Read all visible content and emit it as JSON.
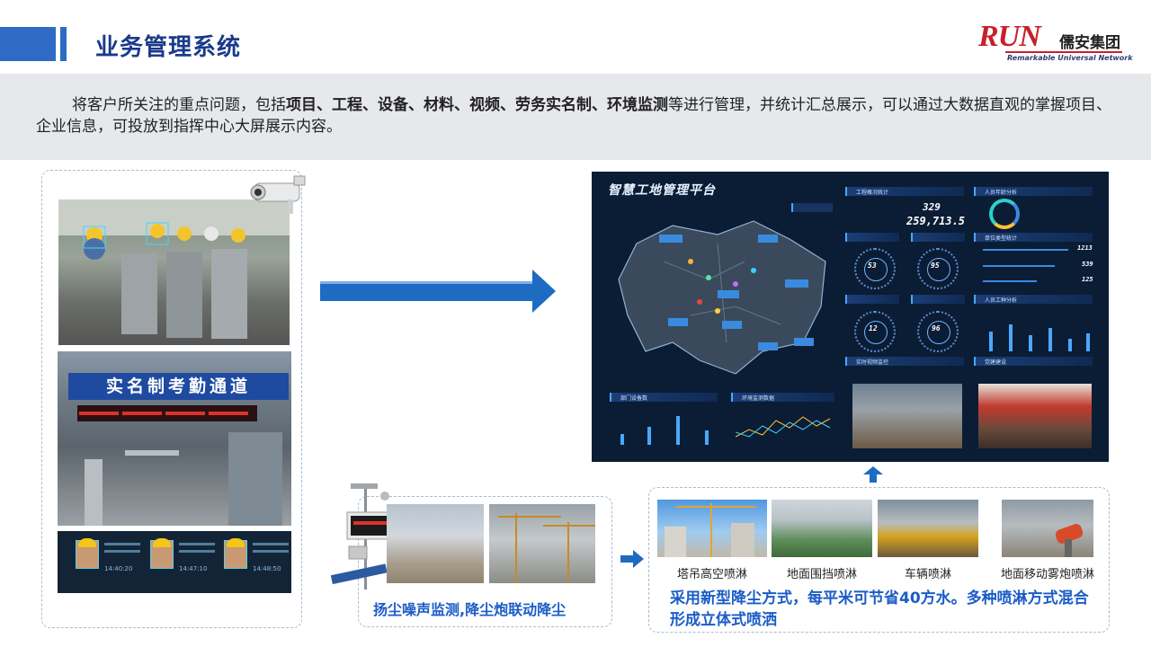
{
  "header": {
    "title": "业务管理系统",
    "logo_mark": "RUN",
    "logo_cn": "儒安集团",
    "logo_en": "Remarkable Universal Network"
  },
  "intro": {
    "lead": "将客户所关注的重点问题，包括",
    "highlights": "项目、工程、设备、材料、视频、劳务实名制、环境监测",
    "tail": "等进行管理，并统计汇总展示，可以通过大数据直观的掌握项目、企业信息，可投放到指挥中心大屏展示内容。"
  },
  "left_panel": {
    "gate_sign": "实名制考勤通道",
    "face_times": [
      "14:40:20",
      "14:47:10",
      "14:48:50"
    ]
  },
  "dashboard": {
    "title": "智慧工地管理平台",
    "panel_project_stats": "工程概况统计",
    "project_count": "329",
    "area_total": "259,713.5",
    "panel_age": "人员年龄分析",
    "panel_unit": "单位类型统计",
    "unit_values": [
      "1213",
      "539",
      "125"
    ],
    "gauge_values": [
      "53",
      "95",
      "12",
      "96"
    ],
    "panel_worker": "人员工种分析",
    "panel_video": "实时视频监控",
    "panel_party": "党建建设",
    "panel_device": "部门设备数",
    "panel_env": "环境监测数据"
  },
  "dust": {
    "caption": "扬尘噪声监测,降尘炮联动降尘"
  },
  "spray": {
    "labels": [
      "塔吊高空喷淋",
      "地面围挡喷淋",
      "车辆喷淋",
      "地面移动雾炮喷淋"
    ],
    "caption": "采用新型降尘方式，每平米可节省40方水。多种喷淋方式混合形成立体式喷洒"
  },
  "colors": {
    "accent": "#2d6bc4",
    "title": "#1a3a8a",
    "caption_blue": "#1b5cc7",
    "dashboard_bg": "#0b1c35"
  }
}
